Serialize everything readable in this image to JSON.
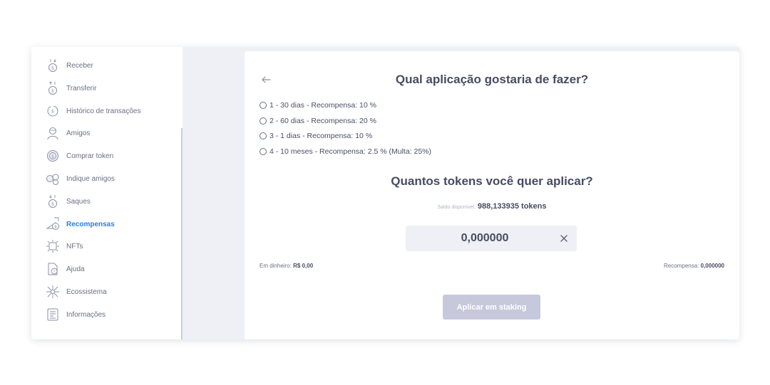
{
  "sidebar": {
    "items": [
      {
        "label": "Receber",
        "icon": "receive-coin-icon",
        "active": false
      },
      {
        "label": "Transferir",
        "icon": "transfer-coin-icon",
        "active": false
      },
      {
        "label": "Histórico de transações",
        "icon": "history-icon",
        "active": false
      },
      {
        "label": "Amigos",
        "icon": "friends-icon",
        "active": false
      },
      {
        "label": "Comprar token",
        "icon": "buy-token-icon",
        "active": false
      },
      {
        "label": "Indique amigos",
        "icon": "refer-friends-icon",
        "active": false
      },
      {
        "label": "Saques",
        "icon": "withdraw-icon",
        "active": false
      },
      {
        "label": "Recompensas",
        "icon": "rewards-icon",
        "active": true
      },
      {
        "label": "NFTs",
        "icon": "nft-icon",
        "active": false
      },
      {
        "label": "Ajuda",
        "icon": "help-icon",
        "active": false
      },
      {
        "label": "Ecossistema",
        "icon": "ecosystem-icon",
        "active": false
      },
      {
        "label": "Informações",
        "icon": "info-icon",
        "active": false
      }
    ]
  },
  "main": {
    "title": "Qual aplicação gostaria de fazer?",
    "options": [
      {
        "label": "1 - 30  dias - Recompensa:  10 %"
      },
      {
        "label": "2 - 60  dias - Recompensa:  20 %"
      },
      {
        "label": "3 - 1  dias - Recompensa:  10 %"
      },
      {
        "label": "4 - 10  meses - Recompensa:  2.5 %  (Multa: 25%)"
      }
    ],
    "tokens_title": "Quantos tokens você quer aplicar?",
    "saldo_label": "Saldo disponível:",
    "saldo_value": "988,133935 tokens",
    "amount_value": "0,000000",
    "cash_label": "Em dinheiro:",
    "cash_value": "R$ 0,00",
    "reward_label": "Recompensa:",
    "reward_value": "0,000000",
    "stake_button": "Aplicar em staking"
  },
  "colors": {
    "accent": "#2b7fe0",
    "button_disabled": "#c6c9dc",
    "background": "#eef0f5",
    "text": "#474c63"
  }
}
